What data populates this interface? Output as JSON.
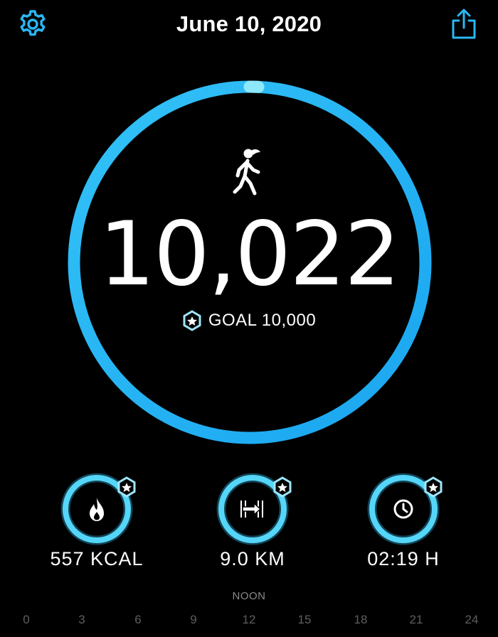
{
  "header": {
    "date": "June 10, 2020",
    "settings_icon": "gear-icon",
    "share_icon": "share-icon"
  },
  "activity": {
    "icon": "walking-person-icon",
    "steps": "10,022",
    "goal_label": "GOAL 10,000",
    "goal_icon": "goal-badge-icon",
    "progress": 1.0
  },
  "metrics": [
    {
      "icon": "flame-icon",
      "value": "557 KCAL",
      "badge_icon": "goal-badge-icon"
    },
    {
      "icon": "distance-arrow-icon",
      "value": "9.0 KM",
      "badge_icon": "goal-badge-icon"
    },
    {
      "icon": "clock-icon",
      "value": "02:19 H",
      "badge_icon": "goal-badge-icon"
    }
  ],
  "timeline": {
    "noon_label": "NOON",
    "hours": [
      "0",
      "3",
      "6",
      "9",
      "12",
      "15",
      "18",
      "21",
      "24"
    ]
  },
  "colors": {
    "accent": "#2ab7f4",
    "accent_light": "#7ee7fb",
    "background": "#000000"
  }
}
